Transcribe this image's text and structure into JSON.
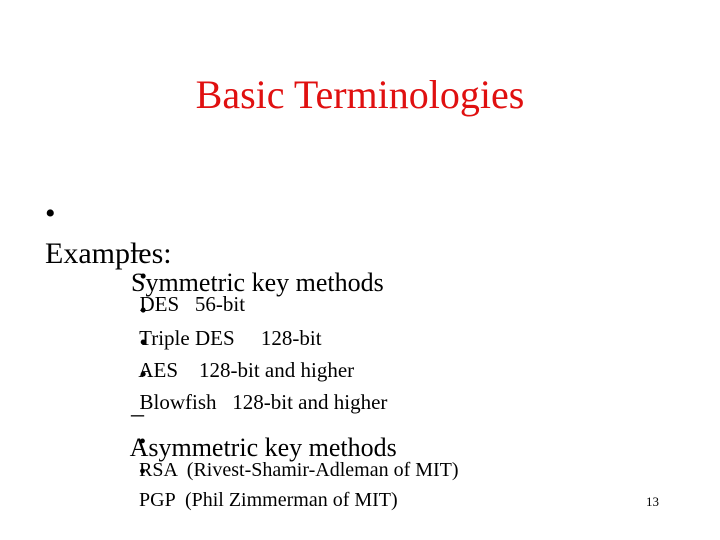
{
  "slide": {
    "title": "Basic Terminologies",
    "title_color": "#e01010",
    "page_number": "13",
    "bullets": {
      "main": {
        "marker": "•",
        "text": "Examples:"
      },
      "symmetric": {
        "marker": "–",
        "text": "Symmetric key methods",
        "items": [
          {
            "marker": "•",
            "text": "DES   56-bit"
          },
          {
            "marker": "•",
            "text": "Triple DES     128-bit"
          },
          {
            "marker": "•",
            "text": "AES    128-bit and higher"
          },
          {
            "marker": "•",
            "text": "Blowfish   128-bit and higher"
          }
        ]
      },
      "asymmetric": {
        "marker": "–",
        "text": "Asymmetric key methods",
        "items": [
          {
            "marker": "•",
            "text": "RSA  (Rivest-Shamir-Adleman of MIT)"
          },
          {
            "marker": "•",
            "text": "PGP  (Phil Zimmerman of MIT)"
          }
        ]
      }
    }
  }
}
